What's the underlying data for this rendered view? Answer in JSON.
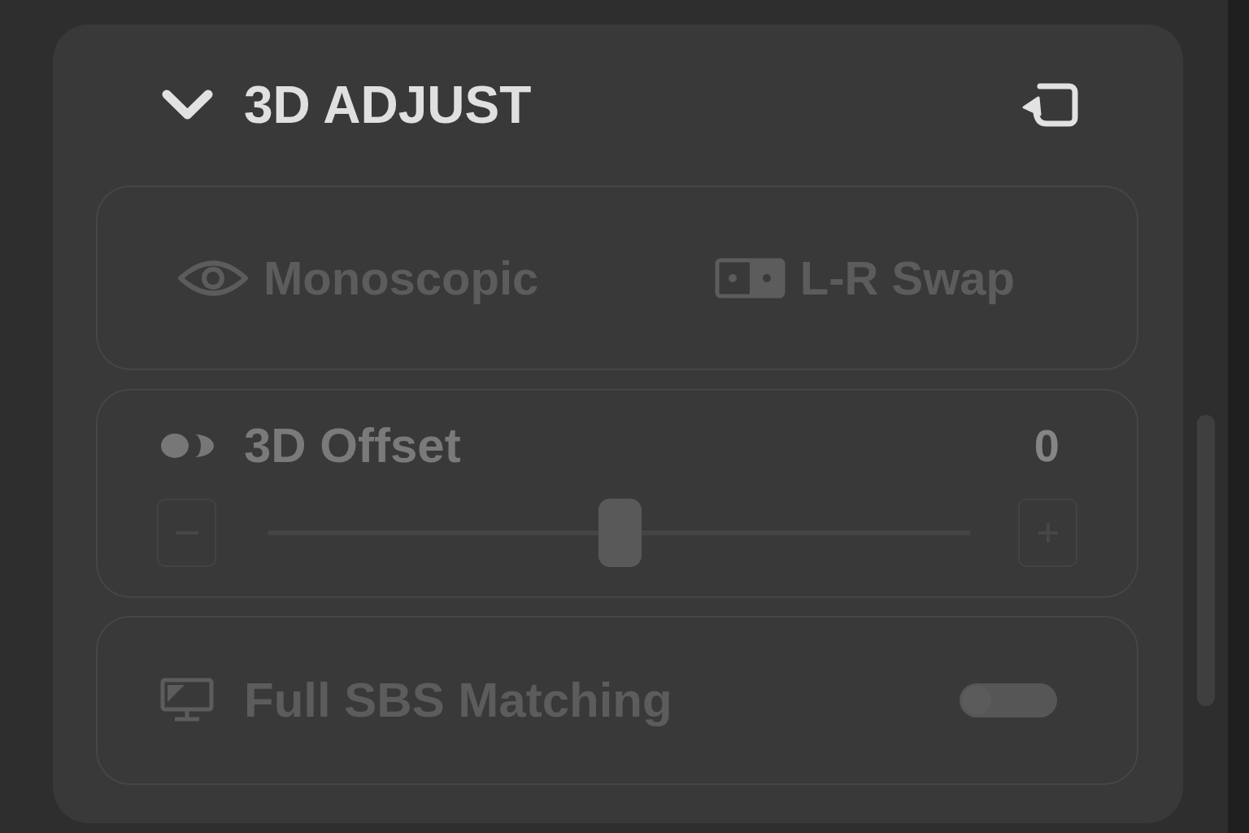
{
  "section": {
    "title": "3D ADJUST",
    "expanded": true
  },
  "view_modes": [
    {
      "kind": "mono",
      "label": "Monoscopic",
      "disabled": true
    },
    {
      "kind": "swap",
      "label": "L-R Swap",
      "disabled": true
    }
  ],
  "offset": {
    "label": "3D Offset",
    "value": "0",
    "level": 0.5
  },
  "full_sbs": {
    "label": "Full SBS Matching",
    "on": false,
    "disabled": true
  }
}
